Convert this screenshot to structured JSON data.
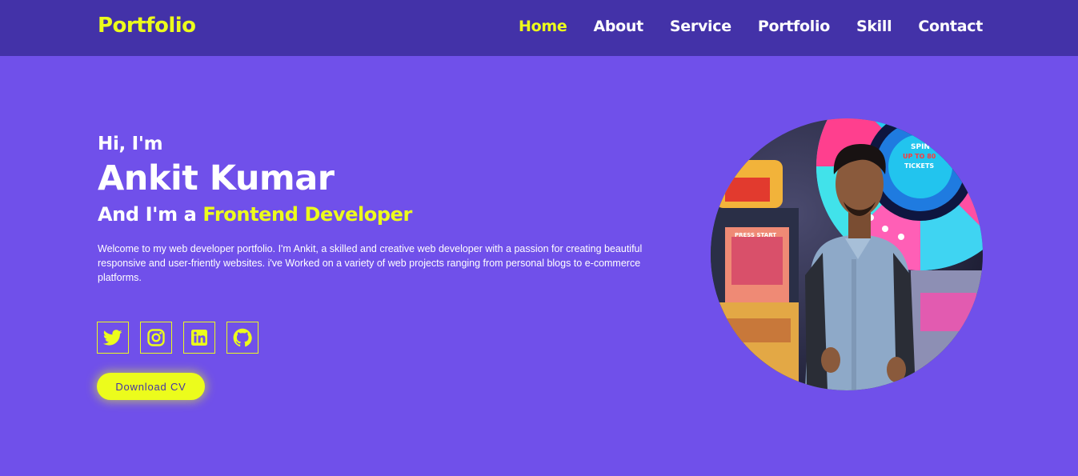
{
  "nav": {
    "logo": "Portfolio",
    "links": [
      "Home",
      "About",
      "Service",
      "Portfolio",
      "Skill",
      "Contact"
    ]
  },
  "hero": {
    "greeting": "Hi, I'm",
    "name": "Ankit Kumar",
    "role_prefix": "And I'm a",
    "role_highlight": "Frontend Developer",
    "bio": "Welcome to my web developer portfolio. I'm Ankit, a skilled and creative web developer with a passion for creating beautiful responsive and user-friently websites. i've Worked on a variety of web projects ranging from personal blogs to e-commerce platforms.",
    "download_label": "Download CV"
  },
  "socials": [
    {
      "icon": "twitter-icon"
    },
    {
      "icon": "instagram-icon"
    },
    {
      "icon": "linkedin-icon"
    },
    {
      "icon": "github-icon"
    }
  ],
  "photo_text": {
    "wheel_label_1": "SPIN-A-",
    "wheel_label_2": "UP TO 80",
    "wheel_label_3": "TICKETS",
    "arcade_label": "PRESS START"
  },
  "colors": {
    "background": "#7050ea",
    "navbar": "#4332a8",
    "accent": "#ecfc1c",
    "text": "#ffffff"
  }
}
